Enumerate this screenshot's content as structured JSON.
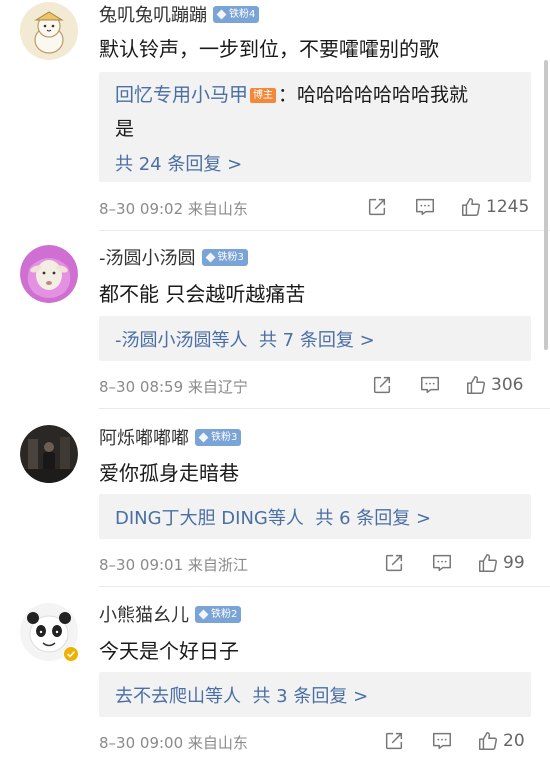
{
  "comments": [
    {
      "username": "兔叽兔叽蹦蹦",
      "badge": "铁粉4",
      "text": "默认铃声，一步到位，不要嚯嚯别的歌",
      "reply": {
        "author": "回忆专用小马甲",
        "author_badge": "博主",
        "text_line1": "：哈哈哈哈哈哈哈我就",
        "text_line2": "是",
        "summary": "共 24 条回复 >"
      },
      "meta": "8–30 09:02  来自山东",
      "likes": "1245"
    },
    {
      "username": "-汤圆小汤圆",
      "badge": "铁粉3",
      "text": "都不能 只会越听越痛苦",
      "reply": {
        "summary_link": "-汤圆小汤圆等人",
        "summary_count": "共 7 条回复 >"
      },
      "meta": "8–30 08:59  来自辽宁",
      "likes": "306"
    },
    {
      "username": "阿烁嘟嘟嘟",
      "badge": "铁粉3",
      "text": "爱你孤身走暗巷",
      "reply": {
        "summary_link": "DING丁大胆 DING等人",
        "summary_count": "共 6 条回复 >"
      },
      "meta": "8–30 09:01  来自浙江",
      "likes": "99"
    },
    {
      "username": "小熊猫幺儿",
      "badge": "铁粉2",
      "text": "今天是个好日子",
      "reply": {
        "summary_link": "去不去爬山等人",
        "summary_count": "共 3 条回复 >"
      },
      "meta": "8–30 09:00  来自山东",
      "likes": "20"
    }
  ],
  "icons": {
    "share": "share-icon",
    "comment": "comment-icon",
    "like": "thumbs-up-icon",
    "diamond": "diamond-icon",
    "verified": "verified-icon"
  },
  "colors": {
    "link": "#4a6fa5",
    "badge": "#7aa3d6",
    "host_badge": "#f08a3a",
    "verified": "#f0b000"
  }
}
